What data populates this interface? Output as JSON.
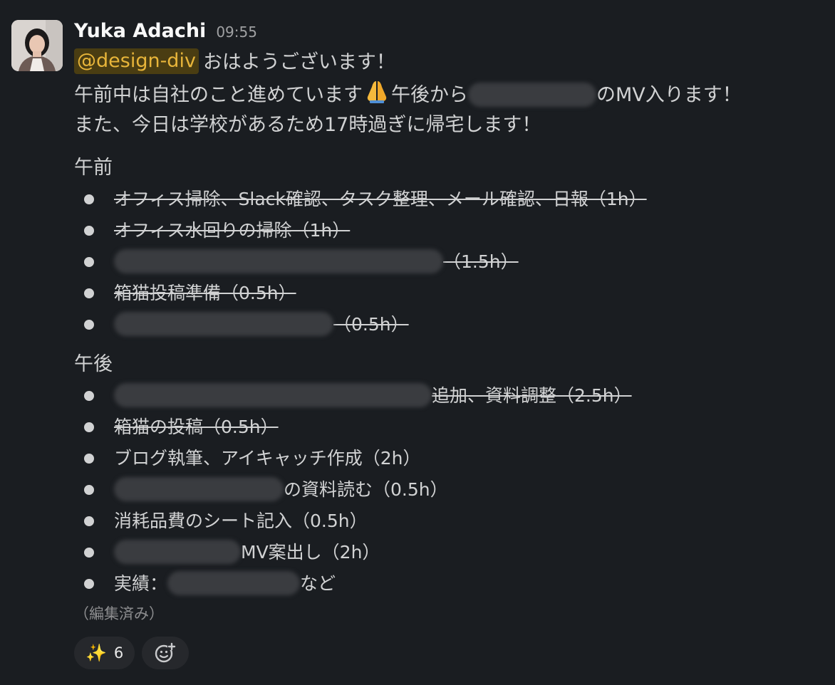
{
  "message": {
    "author": "Yuka Adachi",
    "time": "09:55",
    "mention": "@design-div",
    "greeting": "おはようございます！",
    "line2_part1": "午前中は自社のこと進めています",
    "line2_part2": "午後から",
    "line2_part3": "のMV入ります！",
    "line3": "また、今日は学校があるため17時過ぎに帰宅します！",
    "edited": "（編集済み）"
  },
  "morning": {
    "title": "午前",
    "items": [
      {
        "text": "オフィス掃除、Slack確認、タスク整理、メール確認、日報（1h）",
        "done": true
      },
      {
        "text": "オフィス水回りの掃除（1h）",
        "done": true
      },
      {
        "text": "（1.5h）",
        "done": true,
        "redacted": true
      },
      {
        "text": "箱猫投稿準備（0.5h）",
        "done": true
      },
      {
        "text": "（0.5h）",
        "done": true,
        "redacted": true
      }
    ]
  },
  "afternoon": {
    "title": "午後",
    "items": [
      {
        "text": "追加、資料調整（2.5h）",
        "done": true,
        "redacted": true
      },
      {
        "text": "箱猫の投稿（0.5h）",
        "done": true
      },
      {
        "text": "ブログ執筆、アイキャッチ作成（2h）",
        "done": false
      },
      {
        "text": "の資料読む（0.5h）",
        "done": false,
        "redacted": true
      },
      {
        "text": "消耗品費のシート記入（0.5h）",
        "done": false
      },
      {
        "text": "MV案出し（2h）",
        "done": false,
        "redacted": true
      },
      {
        "text_prefix": "実績：",
        "text_suffix": "など",
        "done": false,
        "redacted": true
      }
    ]
  },
  "reactions": [
    {
      "emoji": "✨",
      "icon": "sparkles-icon",
      "count": "6"
    }
  ],
  "add_reaction_icon": "add-reaction-icon"
}
